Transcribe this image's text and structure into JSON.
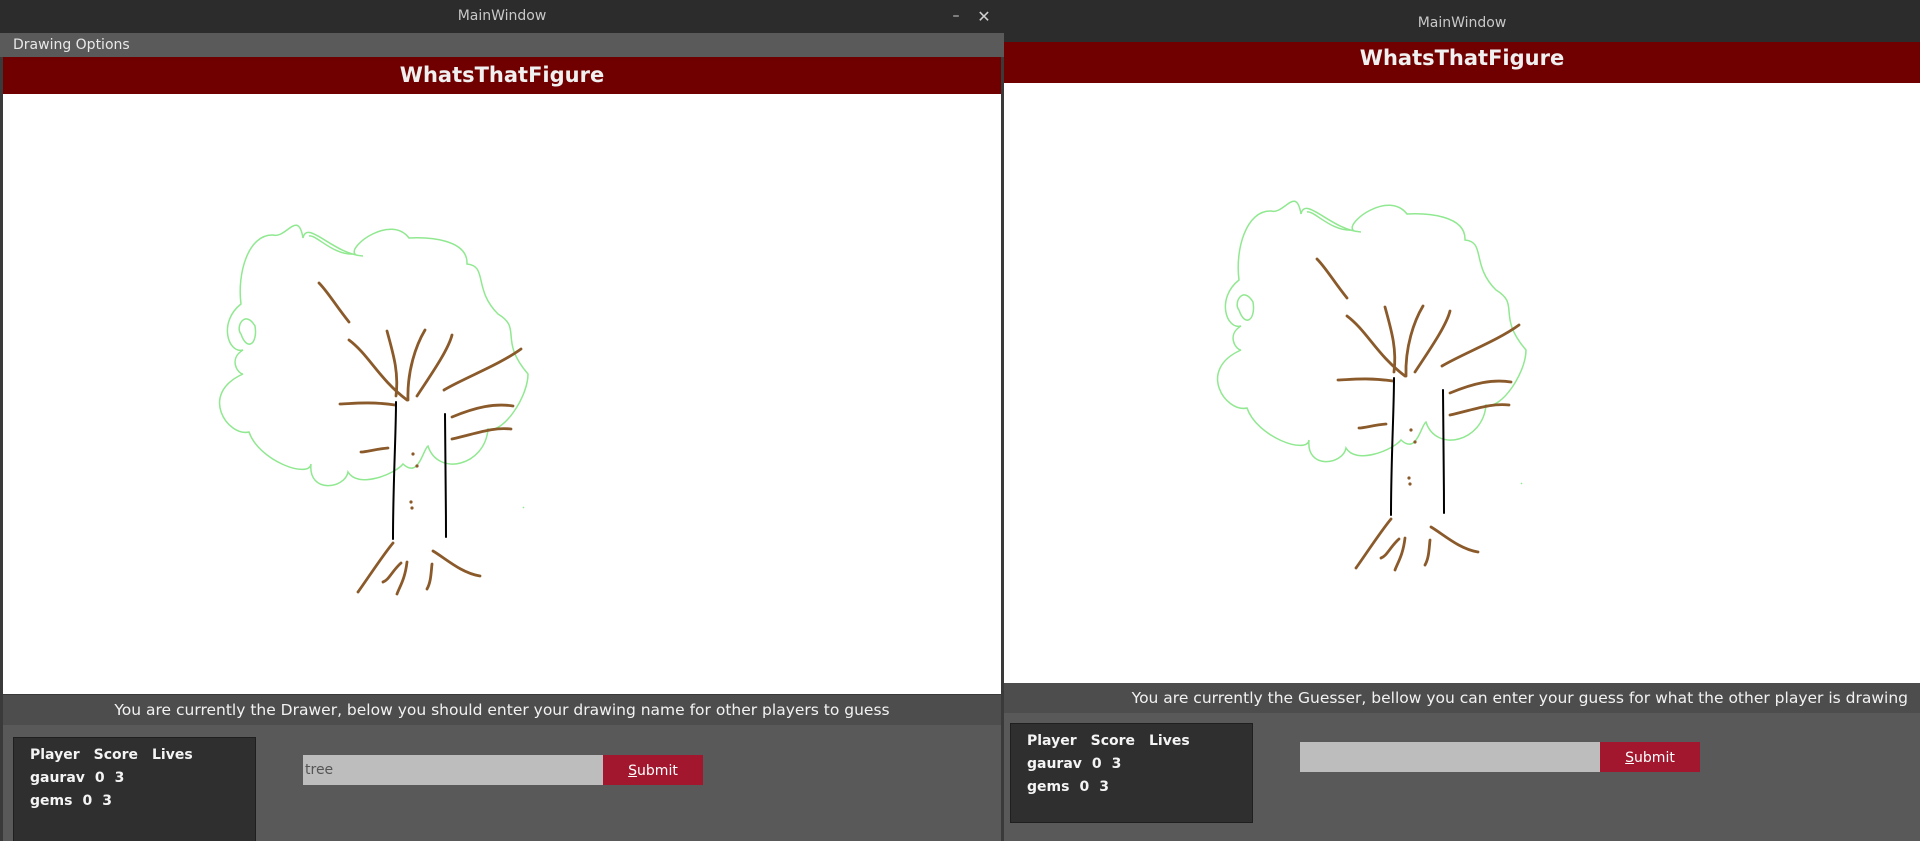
{
  "drawer_window": {
    "title": "MainWindow",
    "minimize_glyph": "–",
    "close_glyph": "✕",
    "menu": {
      "drawing_options": "Drawing Options"
    },
    "app_title": "WhatsThatFigure",
    "status": "You are currently the Drawer, below you should enter your drawing name for other players to guess",
    "scoreboard": {
      "headers": [
        "Player",
        "Score",
        "Lives"
      ],
      "rows": [
        {
          "player": "gaurav",
          "score": "0",
          "lives": "3"
        },
        {
          "player": "gems",
          "score": "0",
          "lives": "3"
        }
      ]
    },
    "input": {
      "value": "tree",
      "placeholder": ""
    },
    "submit": {
      "mnemonic": "S",
      "rest": "ubmit"
    }
  },
  "guesser_window": {
    "title": "MainWindow",
    "app_title": "WhatsThatFigure",
    "status": "You are currently the Guesser, bellow you can enter your guess for what the other player is drawing",
    "scoreboard": {
      "headers": [
        "Player",
        "Score",
        "Lives"
      ],
      "rows": [
        {
          "player": "gaurav",
          "score": "0",
          "lives": "3"
        },
        {
          "player": "gems",
          "score": "0",
          "lives": "3"
        }
      ]
    },
    "input": {
      "value": "",
      "placeholder": ""
    },
    "submit": {
      "mnemonic": "S",
      "rest": "ubmit"
    }
  },
  "drawing": {
    "subject_hint": "tree",
    "foliage_color": "#90e890",
    "branch_color": "#8b5a2b",
    "trunk_color": "#000000"
  },
  "colors": {
    "header": "#700000",
    "submit": "#a3172e",
    "status_bar": "#4d4d4d"
  }
}
